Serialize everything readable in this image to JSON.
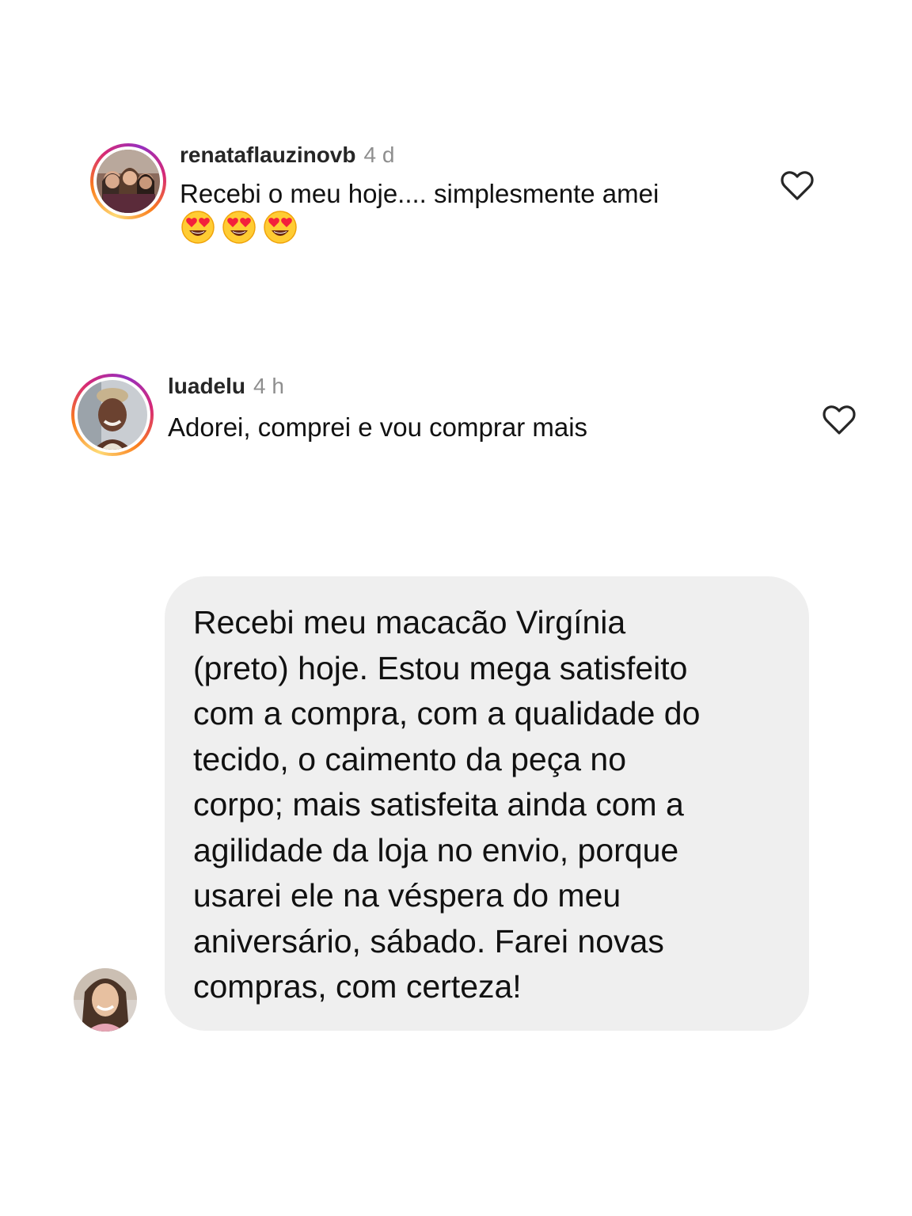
{
  "comments": [
    {
      "username": "renataflauzinovb",
      "time": "4 d",
      "text": "Recebi o meu hoje.... simplesmente amei",
      "emojis": [
        "heart-eyes-emoji",
        "heart-eyes-emoji",
        "heart-eyes-emoji"
      ],
      "like_icon": "heart-outline-icon"
    },
    {
      "username": "luadelu",
      "time": "4 h",
      "text": "Adorei, comprei e vou comprar mais",
      "like_icon": "heart-outline-icon"
    }
  ],
  "message": {
    "text": "Recebi meu macacão Virgínia\n(preto)  hoje. Estou mega satisfeito\ncom a compra, com a qualidade do\ntecido, o caimento da peça no\ncorpo; mais satisfeita ainda com a\nagilidade da loja no envio, porque\nusarei ele na véspera do meu\naniversário, sábado. Farei novas\ncompras, com certeza!",
    "bubble_color": "#efefef"
  },
  "colors": {
    "story_ring": [
      "#feda75",
      "#fa7e1e",
      "#d62976",
      "#962fbf"
    ],
    "username": "#262626",
    "timestamp": "#8e8e8e"
  }
}
